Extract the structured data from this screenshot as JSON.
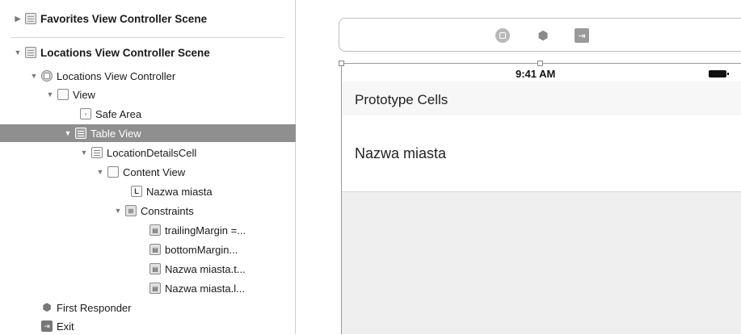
{
  "outline": {
    "scenes": [
      {
        "label": "Favorites View Controller Scene"
      },
      {
        "label": "Locations View Controller Scene"
      }
    ],
    "tree": [
      {
        "label": "Locations View Controller",
        "icon": "view-controller-icon"
      },
      {
        "label": "View",
        "icon": "view-icon"
      },
      {
        "label": "Safe Area",
        "icon": "safe-area-icon"
      },
      {
        "label": "Table View",
        "icon": "table-view-icon"
      },
      {
        "label": "LocationDetailsCell",
        "icon": "table-cell-icon"
      },
      {
        "label": "Content View",
        "icon": "view-icon"
      },
      {
        "label": "Nazwa miasta",
        "icon": "label-icon",
        "glyph": "L"
      },
      {
        "label": "Constraints",
        "icon": "constraints-icon"
      },
      {
        "label": "trailingMargin =...",
        "icon": "trailing-constraint-icon"
      },
      {
        "label": "bottomMargin...",
        "icon": "bottom-constraint-icon"
      },
      {
        "label": "Nazwa miasta.t...",
        "icon": "top-constraint-icon"
      },
      {
        "label": "Nazwa miasta.l...",
        "icon": "leading-constraint-icon"
      },
      {
        "label": "First Responder",
        "icon": "first-responder-icon"
      },
      {
        "label": "Exit",
        "icon": "exit-icon"
      }
    ],
    "selected_item": "Table View"
  },
  "canvas": {
    "status_time": "9:41 AM",
    "prototype_header": "Prototype Cells",
    "cell_label": "Nazwa miasta"
  },
  "colors": {
    "selection": "#8f8f8f",
    "canvas_background": "#efefef",
    "cell_background": "#ffffff"
  }
}
